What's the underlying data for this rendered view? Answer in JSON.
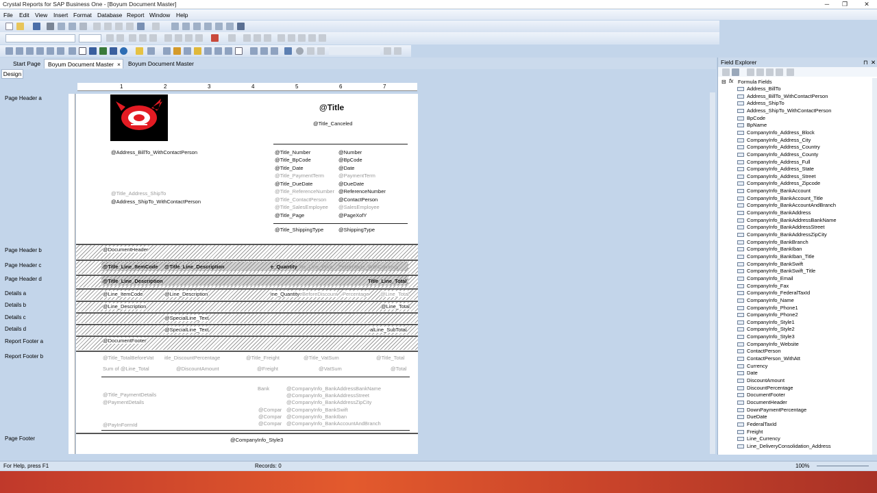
{
  "window": {
    "title": "Crystal Reports for SAP Business One - [Boyum Document Master]",
    "controls": [
      "─",
      "❐",
      "✕"
    ]
  },
  "menu": [
    "File",
    "Edit",
    "View",
    "Insert",
    "Format",
    "Database",
    "Report",
    "Window",
    "Help"
  ],
  "tabs": {
    "items": [
      "Start Page",
      "Boyum Document Master",
      "Boyum Document Master"
    ],
    "close": "×"
  },
  "design_tab": "Design",
  "ruler_ticks": [
    "1",
    "2",
    "3",
    "4",
    "5",
    "6",
    "7"
  ],
  "sections": [
    "Page Header a",
    "Page Header b",
    "Page Header c",
    "Page Header d",
    "Details a",
    "Details b",
    "Details c",
    "Details d",
    "Report Footer a",
    "Report Footer b",
    "Page Footer"
  ],
  "report": {
    "title": "@Title",
    "title_canceled": "@Title_Canceled",
    "address_billto": "@Address_BillTo_WithContactPerson",
    "title_address_shipto": "@Title_Address_ShipTo",
    "address_shipto": "@Address_ShipTo_WithContactPerson",
    "left_fields": [
      "@Title_Number",
      "@Title_BpCode",
      "@Title_Date",
      "@Title_PaymentTerm",
      "@Title_DueDate",
      "@Title_ReferenceNumber",
      "@Title_ContactPerson",
      "@Title_SalesEmployee",
      "@Title_Page"
    ],
    "right_fields": [
      "@Number",
      "@BpCode",
      "@Date",
      "@PaymentTerm",
      "@DueDate",
      "@ReferenceNumber",
      "@ContactPerson",
      "@SalesEmployee",
      "@PageXofY"
    ],
    "title_shipping": "@Title_ShippingType",
    "shipping": "@ShippingType",
    "document_header": "@DocumentHeader",
    "phc": [
      "@Title_Line_ItemCode",
      "@Title_Line_Description",
      "e_Quantity",
      "itle_Line_Price",
      "Percentage_WithCurrency"
    ],
    "phd": [
      "@Title_Line_Description",
      "Title_Line_Total"
    ],
    "da": [
      "@Line_ItemCode",
      "@Line_Description",
      "ine_Quantity",
      "eBeforeDiscount",
      "Percentage",
      "@Line_Total"
    ],
    "db": [
      "@Line_Description",
      "@Line_Total"
    ],
    "dc": "@SpecialLine_Text",
    "dd": [
      "@SpecialLine_Text",
      "alLine_SubTotal"
    ],
    "document_footer": "@DocumentFooter",
    "rfb_titles": [
      "@Title_TotalBeforeVat",
      "itle_DiscountPercentage",
      "@Title_Freight",
      "@Title_VatSum",
      "@Title_Total"
    ],
    "rfb_values": [
      "Sum of @Line_Total",
      "@DiscountAmount",
      "@Freight",
      "@VatSum",
      "@Total"
    ],
    "payment_title": "@Title_PaymentDetails",
    "payment": "@PaymentDetails",
    "payin": "@PayInFormId",
    "bank": "Bank",
    "bank_fields": [
      "@CompanyInfo_BankAddressBankName",
      "@CompanyInfo_BankAddressStreet",
      "@CompanyInfo_BankAddressZipCity",
      "@CompanyInfo_BankSwift",
      "@CompanyInfo_BankIban",
      "@CompanyInfo_BankAccountAndBranch"
    ],
    "compar": [
      "@Compar",
      "@Compar",
      "@Compar"
    ],
    "page_footer": "@CompanyInfo_Style3"
  },
  "field_explorer": {
    "title": "Field Explorer",
    "pin": "⊓",
    "close": "✕",
    "root": "Formula Fields",
    "items": [
      "Address_BillTo",
      "Address_BillTo_WithContactPerson",
      "Address_ShipTo",
      "Address_ShipTo_WithContactPerson",
      "BpCode",
      "BpName",
      "CompanyInfo_Address_Block",
      "CompanyInfo_Address_City",
      "CompanyInfo_Address_Country",
      "CompanyInfo_Address_County",
      "CompanyInfo_Address_Full",
      "CompanyInfo_Address_State",
      "CompanyInfo_Address_Street",
      "CompanyInfo_Address_Zipcode",
      "CompanyInfo_BankAccount",
      "CompanyInfo_BankAccount_Title",
      "CompanyInfo_BankAccountAndBranch",
      "CompanyInfo_BankAddress",
      "CompanyInfo_BankAddressBankName",
      "CompanyInfo_BankAddressStreet",
      "CompanyInfo_BankAddressZipCity",
      "CompanyInfo_BankBranch",
      "CompanyInfo_BankIban",
      "CompanyInfo_BankIban_Title",
      "CompanyInfo_BankSwift",
      "CompanyInfo_BankSwift_Title",
      "CompanyInfo_Email",
      "CompanyInfo_Fax",
      "CompanyInfo_FederalTaxId",
      "CompanyInfo_Name",
      "CompanyInfo_Phone1",
      "CompanyInfo_Phone2",
      "CompanyInfo_Style1",
      "CompanyInfo_Style2",
      "CompanyInfo_Style3",
      "CompanyInfo_Website",
      "ContactPerson",
      "ContactPerson_WithAtt",
      "Currency",
      "Date",
      "DiscountAmount",
      "DiscountPercentage",
      "DocumentFooter",
      "DocumentHeader",
      "DownPaymentPercentage",
      "DueDate",
      "FederalTaxId",
      "Freight",
      "Line_Currency",
      "Line_DeliveryConsolidation_Address"
    ]
  },
  "status": {
    "help": "For Help, press F1",
    "records": "Records: 0",
    "zoom": "100%"
  }
}
